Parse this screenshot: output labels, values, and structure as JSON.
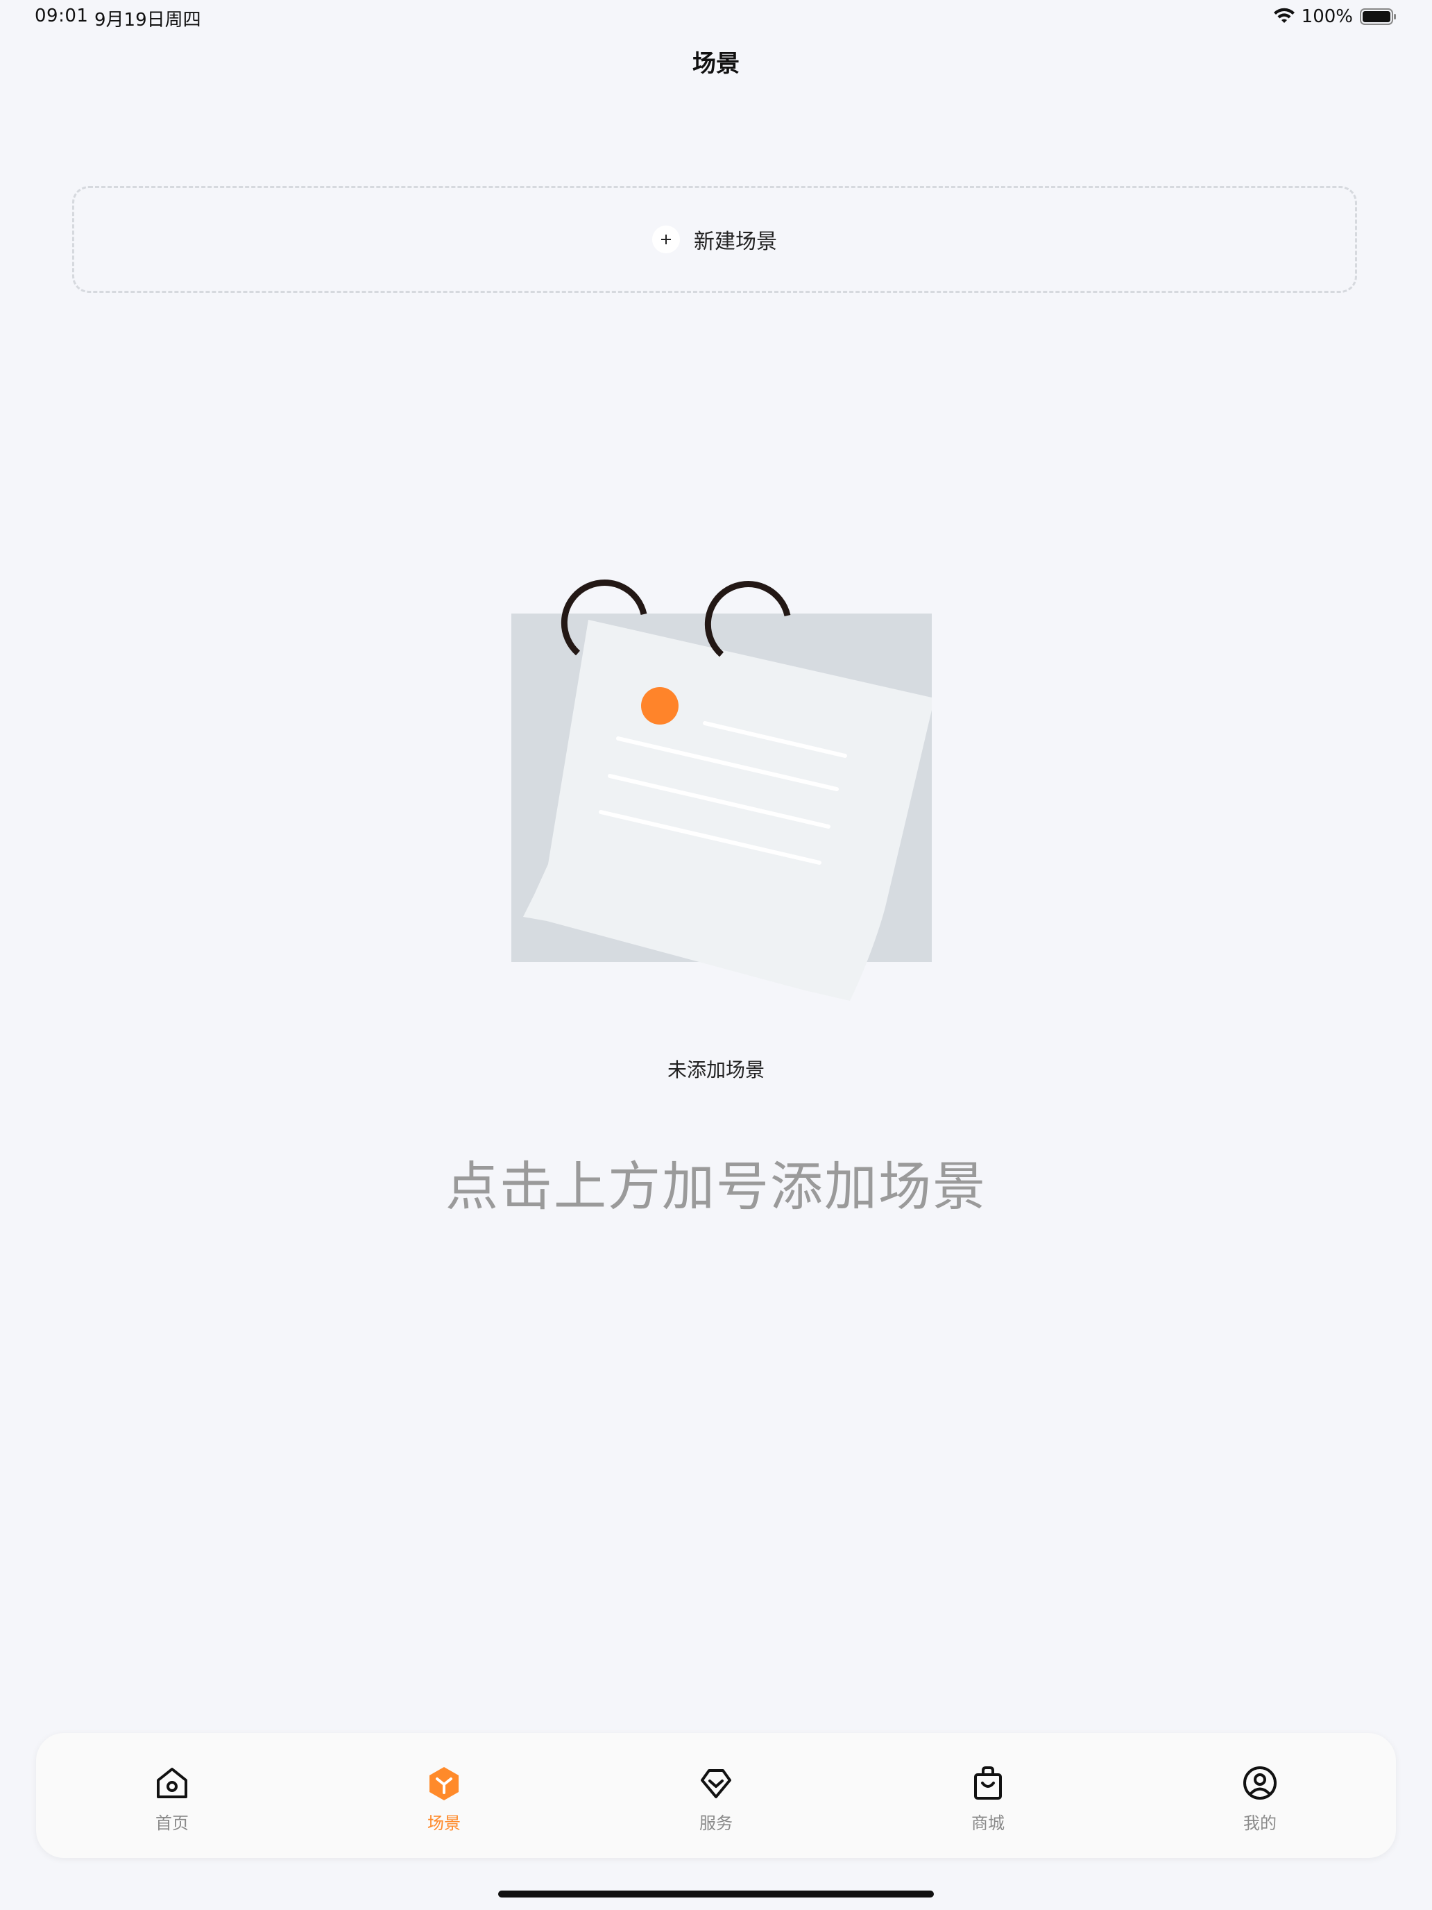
{
  "status_bar": {
    "time": "09:01",
    "date": "9月19日周四",
    "battery": "100%"
  },
  "header": {
    "title": "场景"
  },
  "new_scene": {
    "label": "新建场景"
  },
  "empty_state": {
    "title": "未添加场景",
    "hint": "点击上方加号添加场景"
  },
  "tab_bar": {
    "active_color": "#ff8a2a",
    "inactive_color": "#8a8a8a",
    "items": [
      {
        "label": "首页",
        "icon": "home-icon"
      },
      {
        "label": "场景",
        "icon": "scene-cube-icon"
      },
      {
        "label": "服务",
        "icon": "service-diamond-icon"
      },
      {
        "label": "商城",
        "icon": "shopping-bag-icon"
      },
      {
        "label": "我的",
        "icon": "user-profile-icon"
      }
    ],
    "active_index": 1
  }
}
